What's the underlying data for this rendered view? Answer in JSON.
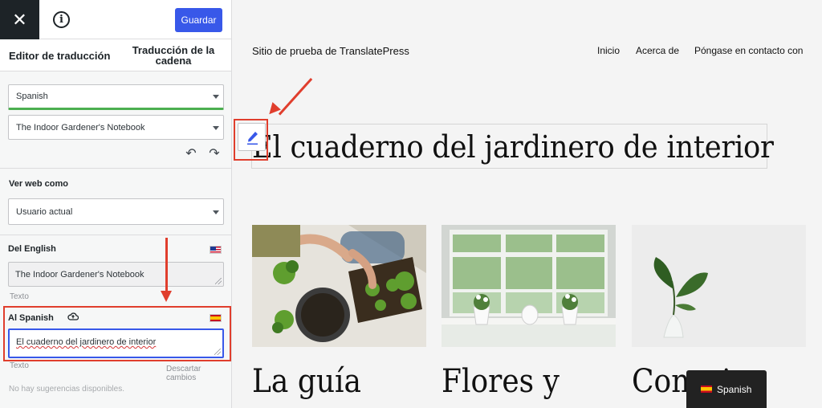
{
  "toolbar": {
    "close_glyph": "✕",
    "info_glyph": "i",
    "save_label": "Guardar"
  },
  "tabs": {
    "editor_label": "Editor de traducción",
    "string_label_line1": "Traducción de la",
    "string_label_line2": "cadena"
  },
  "selectors": {
    "language_value": "Spanish",
    "page_value": "The Indoor Gardener's Notebook"
  },
  "history": {
    "undo_glyph": "↶",
    "redo_glyph": "↷"
  },
  "view_as": {
    "title": "Ver web como",
    "value": "Usuario actual"
  },
  "from": {
    "title": "Del English",
    "text": "The Indoor Gardener's Notebook",
    "hint": "Texto"
  },
  "to": {
    "title": "Al Spanish",
    "text": "El cuaderno del jardinero de interior",
    "hint": "Texto",
    "discard_label": "Descartar cambios",
    "no_suggestions": "No hay sugerencias disponibles."
  },
  "site": {
    "title": "Sitio de prueba de TranslatePress",
    "nav": [
      "Inicio",
      "Acerca de",
      "Póngase en contacto con"
    ],
    "hero_title": "El cuaderno del jardinero de interior",
    "cards": [
      "La guía",
      "Flores y",
      "Consejos"
    ],
    "language_switcher": "Spanish"
  },
  "colors": {
    "accent": "#3858e9",
    "highlight": "#e03e2d",
    "active_underline": "#4caf50"
  },
  "icons": [
    "close-icon",
    "info-icon",
    "cloud-icon",
    "pencil-icon",
    "us-flag-icon",
    "es-flag-icon"
  ]
}
